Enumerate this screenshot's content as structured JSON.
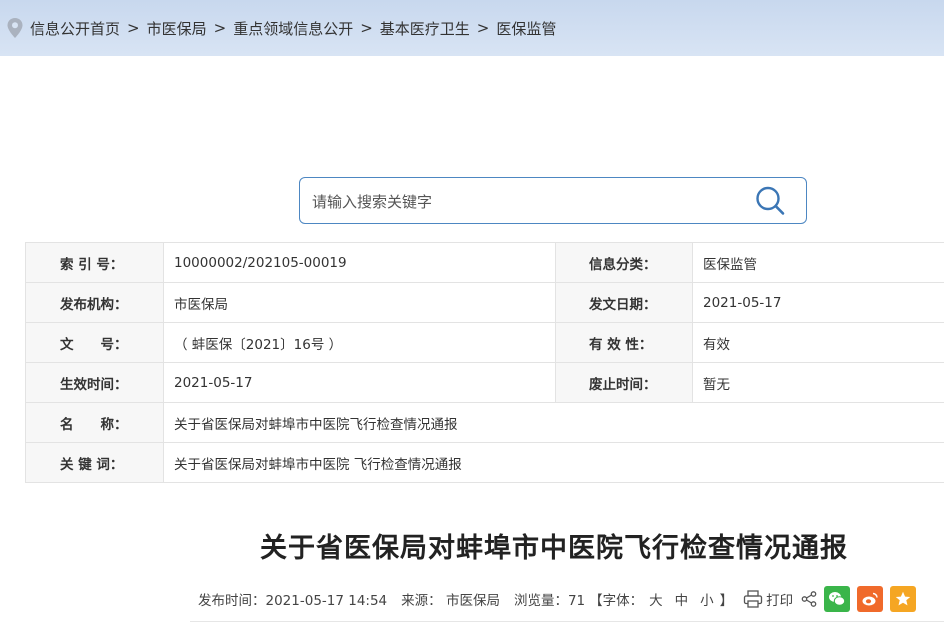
{
  "breadcrumb": {
    "items": [
      "信息公开首页",
      "市医保局",
      "重点领域信息公开",
      "基本医疗卫生",
      "医保监管"
    ],
    "separator": ">"
  },
  "search": {
    "placeholder": "请输入搜索关键字",
    "value": ""
  },
  "meta": {
    "index_label": "索 引 号：",
    "index_value": "10000002/202105-00019",
    "category_label": "信息分类：",
    "category_value": "医保监管",
    "publisher_label": "发布机构：",
    "publisher_value": "市医保局",
    "date_label": "发文日期：",
    "date_value": "2021-05-17",
    "docno_label": "文　　号：",
    "docno_value": "（ 蚌医保〔2021〕16号 ）",
    "validity_label": "有 效 性：",
    "validity_value": "有效",
    "effective_label": "生效时间：",
    "effective_value": "2021-05-17",
    "repeal_label": "废止时间：",
    "repeal_value": "暂无",
    "name_label": "名　　称：",
    "name_value": "关于省医保局对蚌埠市中医院飞行检查情况通报",
    "keywords_label": "关 键 词：",
    "keywords_value": "关于省医保局对蚌埠市中医院 飞行检查情况通报"
  },
  "article": {
    "title": "关于省医保局对蚌埠市中医院飞行检查情况通报",
    "publish_time": "发布时间：2021-05-17 14:54",
    "source": "来源： 市医保局",
    "views": "浏览量：71",
    "font_label": "【字体：",
    "font_large": "大",
    "font_medium": "中",
    "font_small": "小",
    "font_end": "】",
    "print_label": "打印"
  },
  "icons": {
    "location": "location-pin-icon",
    "search": "search-icon",
    "print": "printer-icon",
    "share": "share-icon",
    "wechat": "wechat-icon",
    "weibo": "weibo-icon",
    "favorite": "star-icon"
  },
  "colors": {
    "topbar": "#c8d8ee",
    "search_border": "#4d87c2",
    "label_bg": "#f7f7f7",
    "wechat": "#3ab54a",
    "weibo": "#f06a2b",
    "favorite": "#f5a623"
  }
}
